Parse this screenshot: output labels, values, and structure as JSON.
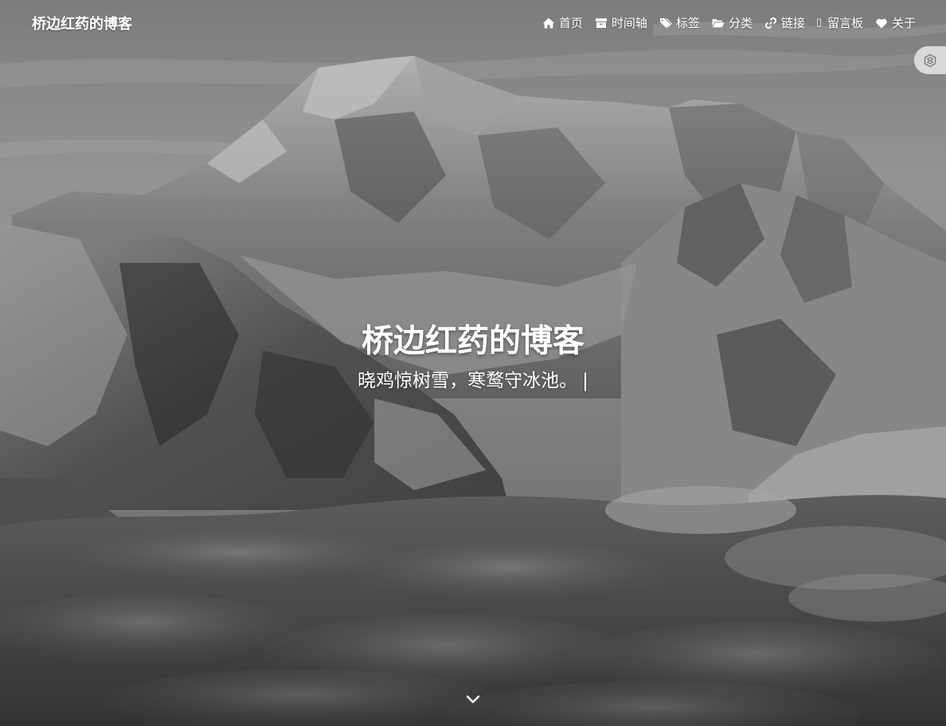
{
  "site": {
    "brand": "桥边红药的博客"
  },
  "nav": {
    "items": [
      {
        "label": "首页",
        "icon": "home-icon"
      },
      {
        "label": "时间轴",
        "icon": "archive-icon"
      },
      {
        "label": "标签",
        "icon": "tags-icon"
      },
      {
        "label": "分类",
        "icon": "folder-open-icon"
      },
      {
        "label": "链接",
        "icon": "link-icon"
      },
      {
        "label": "留言板",
        "icon": "missing-glyph-icon",
        "glyph": "▯"
      },
      {
        "label": "关于",
        "icon": "heart-icon"
      }
    ]
  },
  "hero": {
    "title": "桥边红药的博客",
    "subtitle": "晓鸡惊树雪，寒鹜守冰池。",
    "cursor": "|"
  },
  "theme_toggle": {
    "icon": "theme-switch-icon"
  },
  "scroll_down": {
    "icon": "chevron-down-icon"
  },
  "colors": {
    "text": "#ffffff",
    "toggle_bg": "#d9d9d9",
    "image_tone": "grayscale"
  }
}
